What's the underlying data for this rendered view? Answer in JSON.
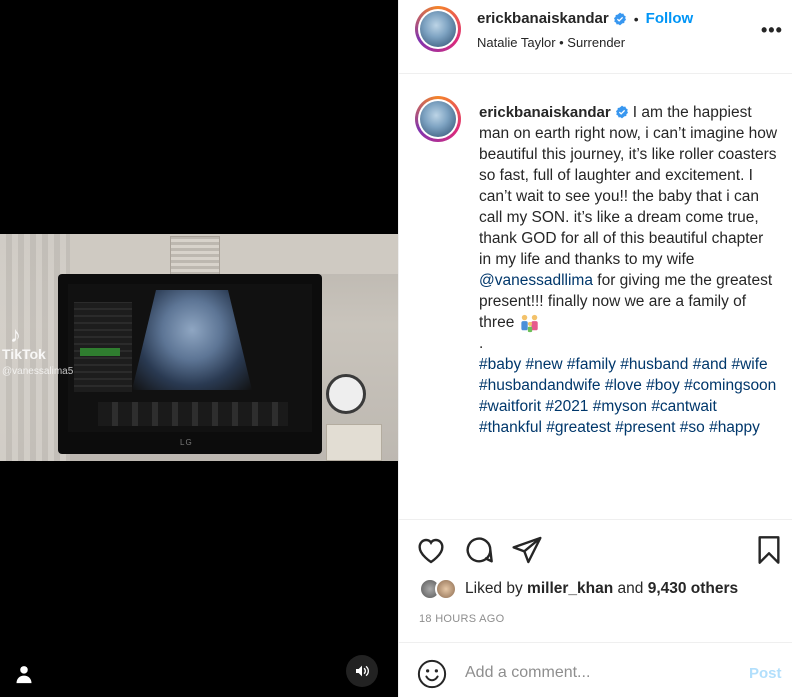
{
  "media": {
    "tiktok_text": "TikTok",
    "tiktok_handle": "@vanessalima5",
    "monitor_brand": "LG",
    "icons": {
      "user_tag": "user-icon",
      "sound": "speaker-icon",
      "tiktok": "tiktok-logo-icon"
    }
  },
  "header": {
    "username": "erickbanaiskandar",
    "follow_label": "Follow",
    "audio": "Natalie Taylor • Surrender",
    "more": "•••"
  },
  "caption": {
    "username": "erickbanaiskandar",
    "text_before_mention": "I am the happiest man on earth right now, i can’t imagine how beautiful this journey, it’s like roller coasters so fast, full of laughter and excitement. I can’t wait to see you!! the baby that i can call my SON. it’s like a dream come true, thank GOD for all of this beautiful chapter in my life and thanks to my wife",
    "mention": "@vanessadllima",
    "text_after_mention": "for giving me the greatest present!!! finally now we are a family of three",
    "separator": ".",
    "hashtags": "#baby #new #family #husband #and #wife #husbandandwife #love #boy #comingsoon #waitforit #2021 #myson #cantwait #thankful #greatest #present #so #happy"
  },
  "likes": {
    "prefix": "Liked by",
    "user": "miller_khan",
    "and": "and",
    "others": "9,430 others"
  },
  "timestamp": "18 HOURS AGO",
  "comment": {
    "placeholder": "Add a comment...",
    "post_label": "Post"
  },
  "colors": {
    "link_blue": "#0095f6",
    "mention_blue": "#00376b",
    "post_disabled": "#b2dffc",
    "muted": "#8e8e8e"
  }
}
